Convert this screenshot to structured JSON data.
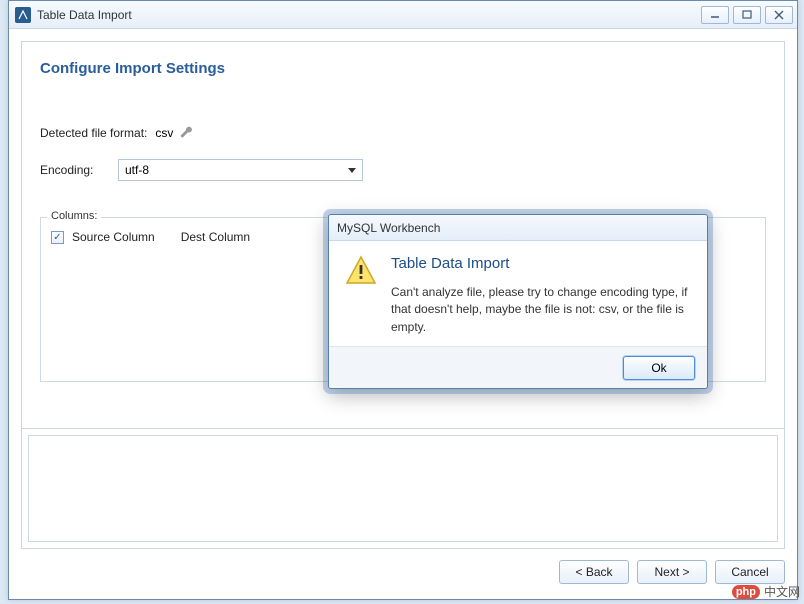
{
  "window": {
    "title": "Table Data Import"
  },
  "page": {
    "heading": "Configure Import Settings",
    "detected_label": "Detected file format:",
    "detected_value": "csv",
    "encoding_label": "Encoding:",
    "encoding_value": "utf-8",
    "columns_legend": "Columns:",
    "source_col": "Source Column",
    "dest_col": "Dest Column"
  },
  "footer": {
    "back": "< Back",
    "next": "Next >",
    "cancel": "Cancel"
  },
  "modal": {
    "title": "MySQL Workbench",
    "heading": "Table Data Import",
    "message": "Can't analyze file, please try to change encoding type, if that doesn't help, maybe the file is not: csv, or the file is empty.",
    "ok": "Ok"
  },
  "watermark": {
    "badge": "php",
    "text": "中文网"
  }
}
